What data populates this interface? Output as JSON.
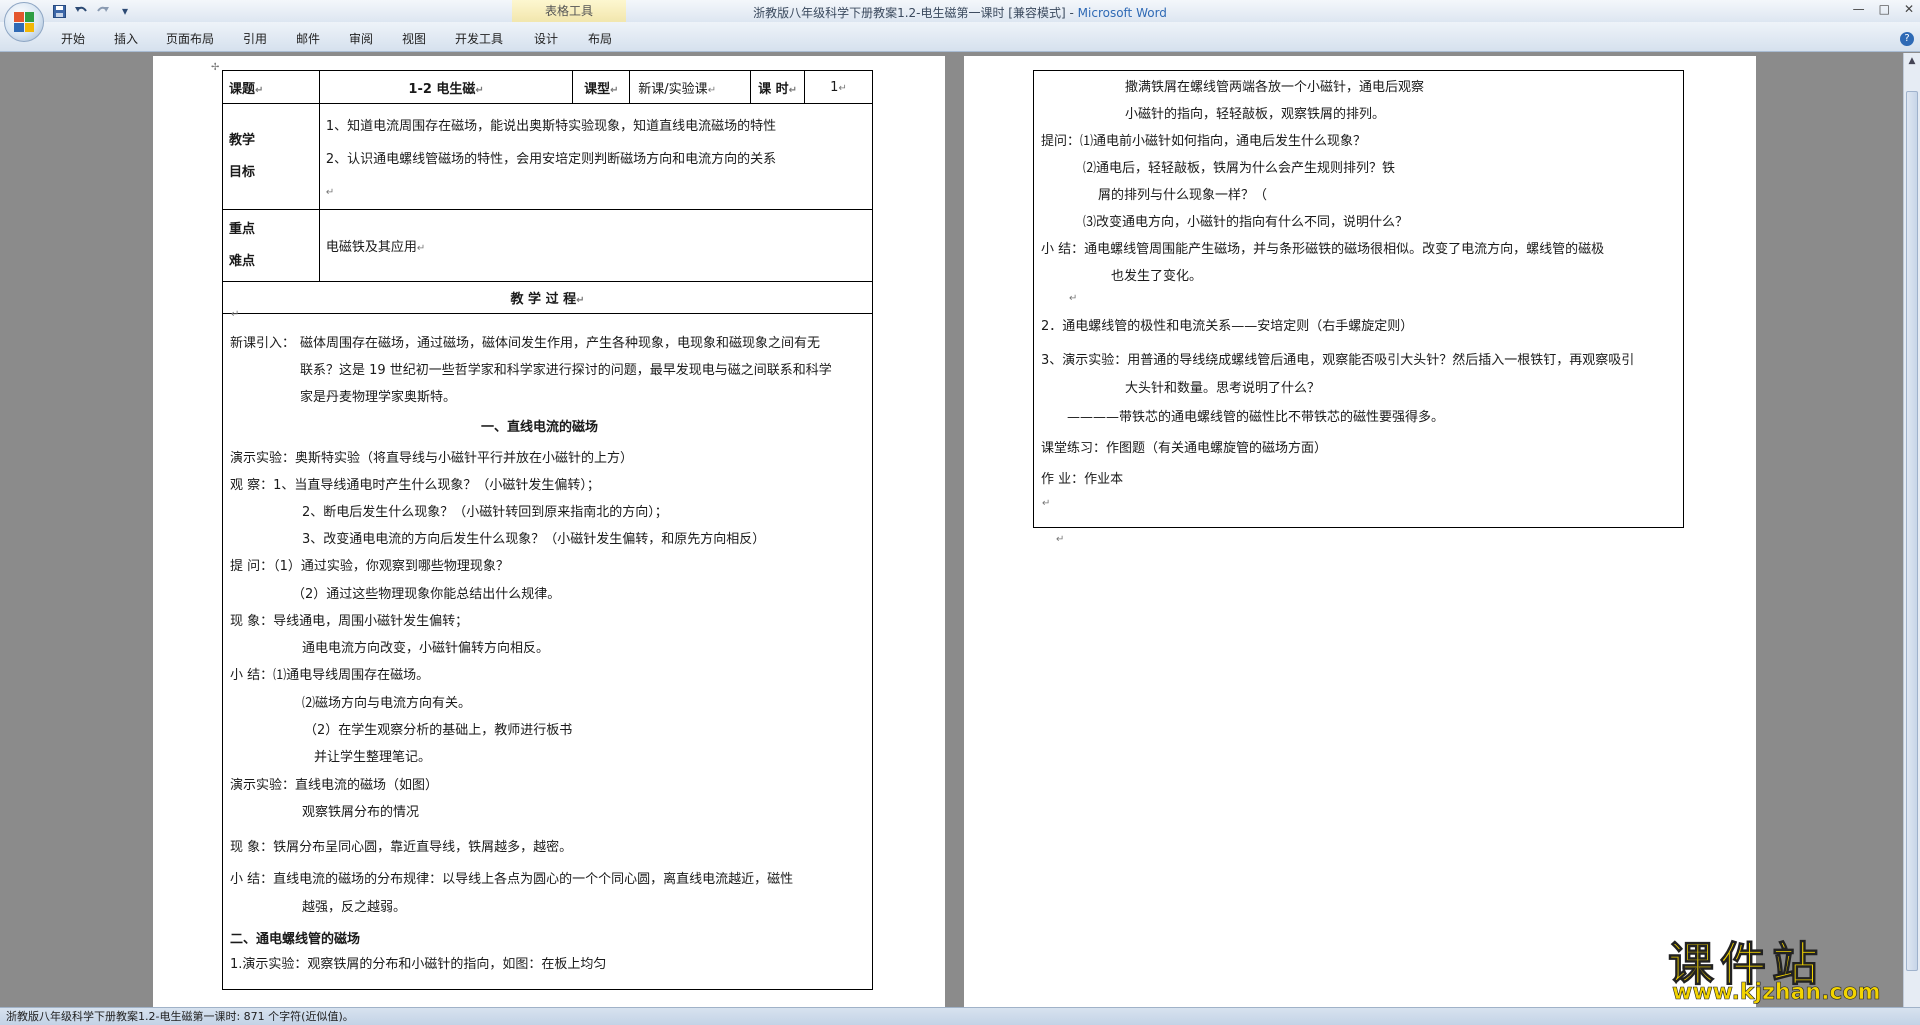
{
  "window": {
    "title": "浙教版八年级科学下册教案1.2-电生磁第一课时 [兼容模式]",
    "app_name": "Microsoft Word",
    "contextual_tab_group": "表格工具",
    "min_glyph": "—",
    "max_glyph": "□",
    "close_glyph": "✕"
  },
  "quick_access": {
    "save_icon": "save-icon",
    "undo_icon": "undo-icon",
    "redo_icon": "redo-icon",
    "customize_glyph": "▾"
  },
  "ribbon": {
    "tabs": [
      "开始",
      "插入",
      "页面布局",
      "引用",
      "邮件",
      "审阅",
      "视图",
      "开发工具",
      "设计",
      "布局"
    ],
    "help_glyph": "?"
  },
  "status_bar": {
    "text": "浙教版八年级科学下册教案1.2-电生磁第一课时: 871 个字符(近似值)。"
  },
  "watermark": {
    "brand": "课件站",
    "url": "www.kjzhan.com"
  },
  "page1": {
    "header": {
      "topic_label": "课题",
      "topic_value": "1-2 电生磁",
      "type_label": "课型",
      "type_value": "新课/实验课",
      "hours_label": "课 时",
      "hours_value": "1"
    },
    "goals_label_1": "教学",
    "goals_label_2": "目标",
    "goals": [
      "1、知道电流周围存在磁场，能说出奥斯特实验现象，知道直线电流磁场的特性",
      "2、认识通电螺线管磁场的特性，会用安培定则判断磁场方向和电流方向的关系"
    ],
    "key_label_1": "重点",
    "key_label_2": "难点",
    "key_value": "电磁铁及其应用",
    "process_title": "教 学 过 程",
    "intro_label": "新课引入：",
    "intro_lines": [
      "磁体周围存在磁场，通过磁场，磁体间发生作用，产生各种现象，电现象和磁现象之间有无",
      "联系？这是 19 世纪初一些哲学家和科学家进行探讨的问题，最早发现电与磁之间联系和科学",
      "家是丹麦物理学家奥斯特。"
    ],
    "section1_title": "一、直线电流的磁场",
    "lines": [
      "演示实验：奥斯特实验（将直导线与小磁针平行并放在小磁针的上方）",
      "观      察：1、当直导线通电时产生什么现象？（小磁针发生偏转）；",
      "2、断电后发生什么现象？（小磁针转回到原来指南北的方向）；",
      "3、改变通电电流的方向后发生什么现象？（小磁针发生偏转，和原先方向相反）",
      "提      问：（1）通过实验，你观察到哪些物理现象？",
      "（2）通过这些物理现象你能总结出什么规律。",
      "现      象：导线通电，周围小磁针发生偏转；",
      "通电电流方向改变，小磁针偏转方向相反。",
      "小      结：⑴通电导线周围存在磁场。",
      "⑵磁场方向与电流方向有关。",
      "（2）在学生观察分析的基础上，教师进行板书",
      "并让学生整理笔记。",
      "演示实验：直线电流的磁场（如图）",
      "观察铁屑分布的情况",
      "现      象：铁屑分布呈同心圆，靠近直导线，铁屑越多，越密。",
      "小      结：直线电流的磁场的分布规律：以导线上各点为圆心的一个个同心圆，离直线电流越近，磁性",
      "越强，反之越弱。"
    ],
    "section2_title": "二、通电螺线管的磁场",
    "section2_line": "1.演示实验：观察铁屑的分布和小磁针的指向，如图：在板上均匀"
  },
  "page2": {
    "lines": [
      "撒满铁屑在螺线管两端各放一个小磁针，通电后观察",
      "小磁针的指向，轻轻敲板，观察铁屑的排列。",
      "提问：⑴通电前小磁针如何指向，通电后发生什么现象？",
      "⑵通电后，轻轻敲板，铁屑为什么会产生规则排列？铁",
      "屑的排列与什么现象一样？（",
      "⑶改变通电方向，小磁针的指向有什么不同，说明什么？",
      "小      结：通电螺线管周围能产生磁场，并与条形磁铁的磁场很相似。改变了电流方向，螺线管的磁极",
      "也发生了变化。",
      "2．通电螺线管的极性和电流关系——安培定则（右手螺旋定则）",
      "3、演示实验：用普通的导线绕成螺线管后通电，观察能否吸引大头针？然后插入一根铁钉，再观察吸引",
      "大头针和数量。思考说明了什么？",
      "————带铁芯的通电螺线管的磁性比不带铁芯的磁性要强得多。",
      "课堂练习：作图题（有关通电螺旋管的磁场方面）",
      "作      业：作业本"
    ]
  },
  "marks": {
    "para": "↵",
    "anchor": "✢"
  },
  "colors": {
    "app_title": "#2f6ab5",
    "workspace": "#8b8b8b",
    "watermark": "#f3d400"
  }
}
